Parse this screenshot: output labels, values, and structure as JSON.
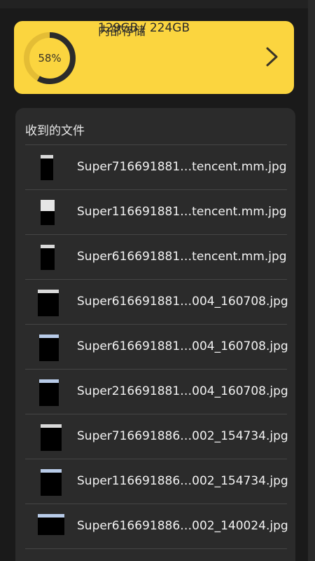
{
  "storage": {
    "percent_label": "58%",
    "used_fraction": 0.58,
    "title": "内部存储",
    "size": "129GB / 224GB",
    "accent_color": "#fbd53f",
    "ring_color": "#2b2b2b",
    "chevron_icon": "chevron-right-icon"
  },
  "files": {
    "header": "收到的文件",
    "items": [
      {
        "name": "Super716691881…tencent.mm.jpg",
        "thumb": "black-screenshot"
      },
      {
        "name": "Super116691881…tencent.mm.jpg",
        "thumb": "white-dialog-screenshot"
      },
      {
        "name": "Super616691881…tencent.mm.jpg",
        "thumb": "black-screenshot"
      },
      {
        "name": "Super616691881…004_160708.jpg",
        "thumb": "black-screenshot"
      },
      {
        "name": "Super616691881…004_160708.jpg",
        "thumb": "blue-sky-screenshot"
      },
      {
        "name": "Super216691881…004_160708.jpg",
        "thumb": "blue-sky-screenshot"
      },
      {
        "name": "Super716691886…002_154734.jpg",
        "thumb": "black-screenshot"
      },
      {
        "name": "Super116691886…002_154734.jpg",
        "thumb": "blue-sky-screenshot"
      },
      {
        "name": "Super616691886…002_140024.jpg",
        "thumb": "blue-sky-screenshot"
      }
    ]
  }
}
